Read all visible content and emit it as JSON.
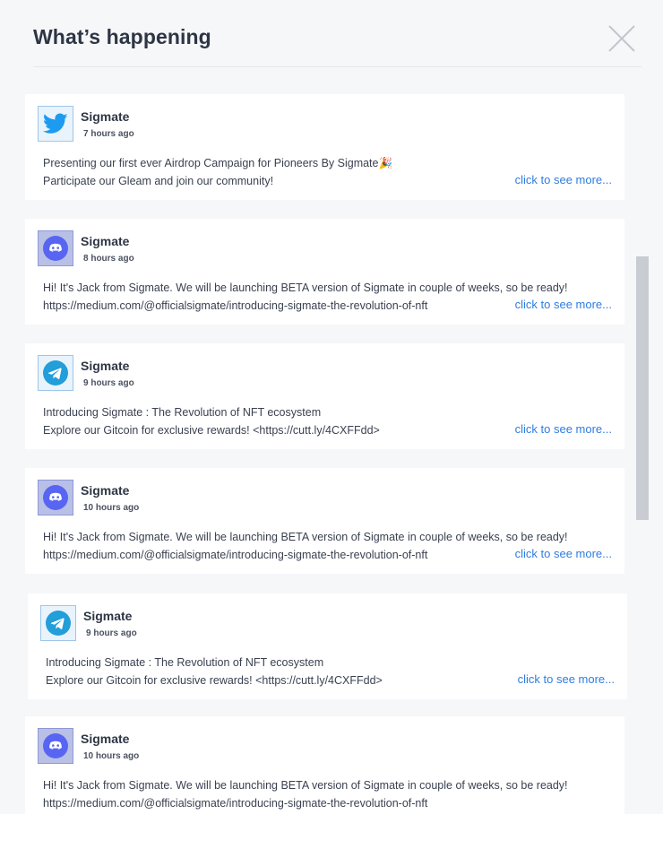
{
  "header": {
    "title": "What’s happening",
    "close_icon": "close-icon"
  },
  "feed": [
    {
      "source": "twitter",
      "icon": "twitter-icon",
      "author": "Sigmate",
      "time": "7 hours ago",
      "line1": "Presenting our first ever Airdrop Campaign for Pioneers By Sigmate🎉",
      "line2": "Participate our Gleam and join our community!",
      "more": "click to see more..."
    },
    {
      "source": "discord",
      "icon": "discord-icon",
      "author": "Sigmate",
      "time": "8 hours ago",
      "line1": "Hi! It's Jack from Sigmate. We will be launching BETA version of Sigmate in couple of weeks, so be ready!",
      "line2": "https://medium.com/@officialsigmate/introducing-sigmate-the-revolution-of-nft",
      "more": "click to see more..."
    },
    {
      "source": "telegram",
      "icon": "telegram-icon",
      "author": "Sigmate",
      "time": "9 hours ago",
      "line1": "Introducing Sigmate : The Revolution of NFT ecosystem",
      "line2": "Explore our Gitcoin for exclusive rewards! <https://cutt.ly/4CXFFdd>",
      "more": "click to see more..."
    },
    {
      "source": "discord",
      "icon": "discord-icon",
      "author": "Sigmate",
      "time": "10 hours ago",
      "line1": "Hi! It's Jack from Sigmate. We will be launching BETA version of Sigmate in couple of weeks, so be ready!",
      "line2": "https://medium.com/@officialsigmate/introducing-sigmate-the-revolution-of-nft",
      "more": "click to see more..."
    },
    {
      "source": "telegram",
      "icon": "telegram-icon",
      "author": "Sigmate",
      "time": "9 hours ago",
      "line1": "Introducing Sigmate : The Revolution of NFT ecosystem",
      "line2": "Explore our Gitcoin for exclusive rewards! <https://cutt.ly/4CXFFdd>",
      "more": "click to see more..."
    },
    {
      "source": "discord",
      "icon": "discord-icon",
      "author": "Sigmate",
      "time": "10 hours ago",
      "line1": "Hi! It's Jack from Sigmate. We will be launching BETA version of Sigmate in couple of weeks, so be ready!",
      "line2": "https://medium.com/@officialsigmate/introducing-sigmate-the-revolution-of-nft",
      "more": ""
    }
  ],
  "colors": {
    "link": "#2f7de1",
    "twitter": "#1d9bf0",
    "telegram": "#229ed9",
    "discord": "#5865f2"
  }
}
